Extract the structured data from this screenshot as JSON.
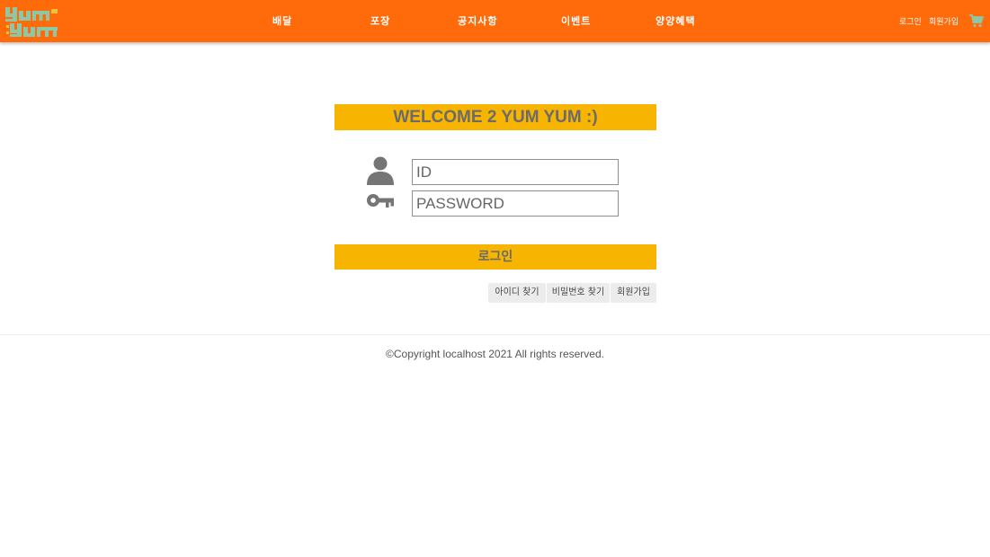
{
  "header": {
    "logo_text": "yum yum",
    "nav": [
      {
        "label": "배달"
      },
      {
        "label": "포장"
      },
      {
        "label": "공지사항"
      },
      {
        "label": "이벤트"
      },
      {
        "label": "양양혜택"
      }
    ],
    "util": {
      "login_label": "로그인",
      "join_label": "회원가입"
    },
    "cart_icon": "cart-icon",
    "background_color": "#ff6a0a"
  },
  "login": {
    "welcome_text": "WELCOME 2 YUM YUM :)",
    "id_placeholder": "ID",
    "password_placeholder": "PASSWORD",
    "login_button_label": "로그인",
    "accent_color": "#f7b400",
    "links": {
      "find_id": "아이디 찾기",
      "find_password": "비밀번호 찾기",
      "join": "회원가입"
    }
  },
  "footer": {
    "copyright": "©Copyright localhost 2021 All rights reserved."
  }
}
